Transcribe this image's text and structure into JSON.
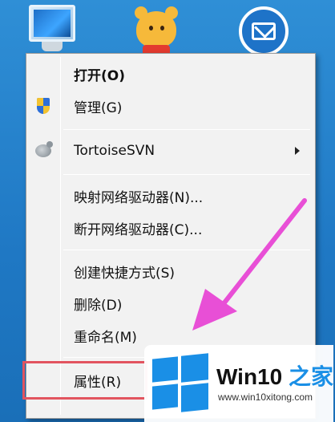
{
  "menu": {
    "items": [
      {
        "label": "打开(O)",
        "bold": true
      },
      {
        "label": "管理(G)",
        "icon": "uac-shield-icon"
      },
      {
        "label": "TortoiseSVN",
        "icon": "tortoisesvn-icon",
        "submenu": true
      },
      {
        "label": "映射网络驱动器(N)..."
      },
      {
        "label": "断开网络驱动器(C)..."
      },
      {
        "label": "创建快捷方式(S)"
      },
      {
        "label": "删除(D)"
      },
      {
        "label": "重命名(M)"
      },
      {
        "label": "属性(R)"
      }
    ]
  },
  "watermark": {
    "brand_main": "Win10",
    "brand_accent": "之家",
    "site": "www.win10xitong.com"
  },
  "colors": {
    "highlight": "#e2545f",
    "arrow": "#e84fd6",
    "windows_blue": "#1a8fe6"
  }
}
